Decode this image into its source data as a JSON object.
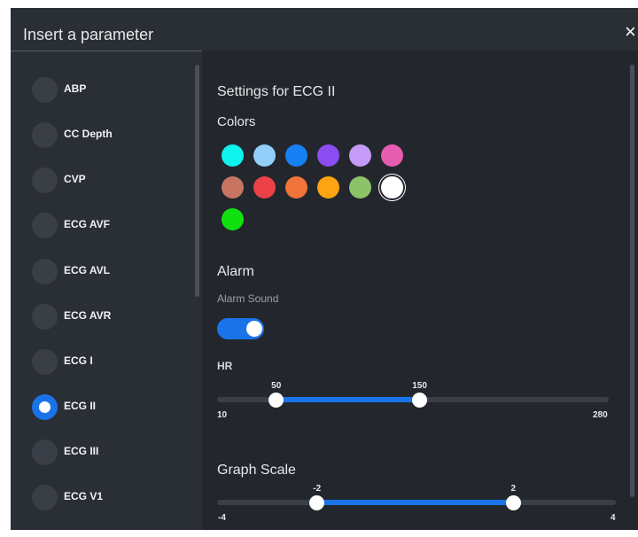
{
  "dialog": {
    "title": "Insert a parameter",
    "close_glyph": "×"
  },
  "parameters": [
    {
      "label": "ABP",
      "selected": false
    },
    {
      "label": "CC Depth",
      "selected": false
    },
    {
      "label": "CVP",
      "selected": false
    },
    {
      "label": "ECG AVF",
      "selected": false
    },
    {
      "label": "ECG AVL",
      "selected": false
    },
    {
      "label": "ECG AVR",
      "selected": false
    },
    {
      "label": "ECG I",
      "selected": false
    },
    {
      "label": "ECG II",
      "selected": true
    },
    {
      "label": "ECG III",
      "selected": false
    },
    {
      "label": "ECG V1",
      "selected": false
    }
  ],
  "settings": {
    "title": "Settings for ECG II",
    "colors_heading": "Colors",
    "colors": [
      "#10f2ee",
      "#92cff9",
      "#1780f2",
      "#8a4df0",
      "#c49bf6",
      "#e65daf",
      "#c87462",
      "#ec4148",
      "#f1743a",
      "#fca411",
      "#8dc368",
      "#ffffff",
      "#10e010"
    ],
    "selected_color": "#ffffff",
    "alarm_heading": "Alarm",
    "alarm_sound_label": "Alarm Sound",
    "alarm_sound_on": true,
    "hr": {
      "label": "HR",
      "min": 10,
      "max": 280,
      "low": 50,
      "high": 150,
      "min_label": "10",
      "max_label": "280",
      "low_label": "50",
      "high_label": "150"
    },
    "graph_scale": {
      "label": "Graph Scale",
      "min": -4,
      "max": 4,
      "low": -2,
      "high": 2,
      "min_label": "-4",
      "max_label": "4",
      "low_label": "-2",
      "high_label": "2"
    }
  },
  "theme": {
    "accent": "#1a73e8",
    "panel": "#2a2e35",
    "content": "#23272d"
  }
}
